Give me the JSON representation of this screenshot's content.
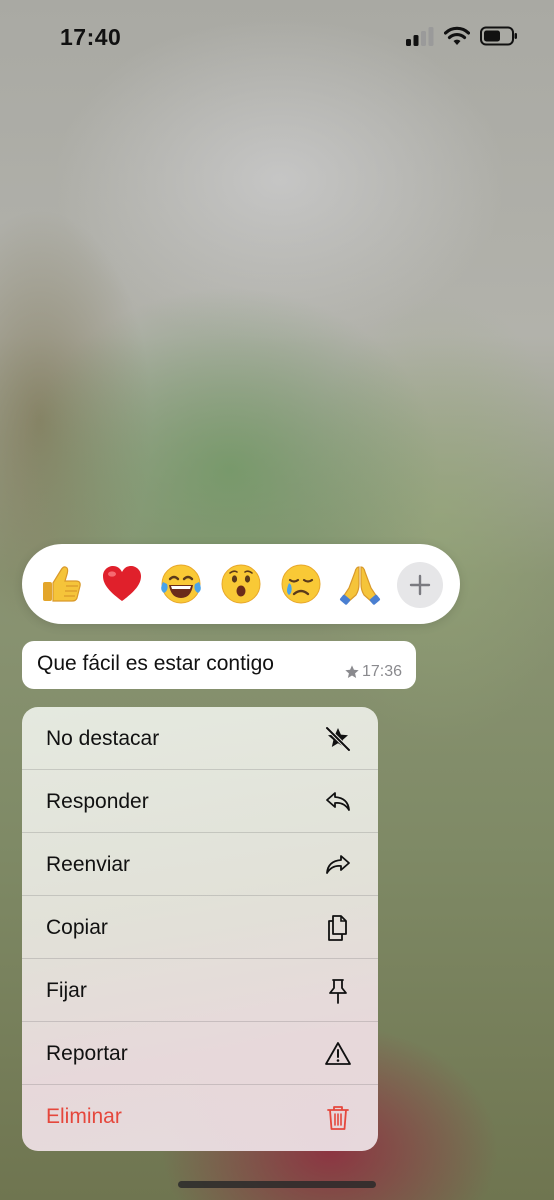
{
  "status_bar": {
    "time": "17:40",
    "icons": [
      "signal-icon",
      "wifi-icon",
      "battery-icon"
    ]
  },
  "reactions": {
    "emojis": [
      {
        "name": "thumbs-up-emoji",
        "glyph": "👍"
      },
      {
        "name": "red-heart-emoji",
        "glyph": "❤️"
      },
      {
        "name": "tears-of-joy-emoji",
        "glyph": "😂"
      },
      {
        "name": "astonished-emoji",
        "glyph": "😮"
      },
      {
        "name": "crying-emoji",
        "glyph": "😢"
      },
      {
        "name": "folded-hands-emoji",
        "glyph": "🙏"
      }
    ],
    "more_icon": "plus-icon"
  },
  "message": {
    "text": "Que fácil es estar contigo",
    "time": "17:36",
    "starred": true
  },
  "menu": {
    "items": [
      {
        "label": "No destacar",
        "icon": "unstar-icon"
      },
      {
        "label": "Responder",
        "icon": "reply-icon"
      },
      {
        "label": "Reenviar",
        "icon": "forward-icon"
      },
      {
        "label": "Copiar",
        "icon": "copy-icon"
      },
      {
        "label": "Fijar",
        "icon": "pin-icon"
      },
      {
        "label": "Reportar",
        "icon": "warning-icon"
      },
      {
        "label": "Eliminar",
        "icon": "trash-icon"
      }
    ]
  },
  "colors": {
    "danger": "#e5473c",
    "bubble": "#ffffff"
  }
}
